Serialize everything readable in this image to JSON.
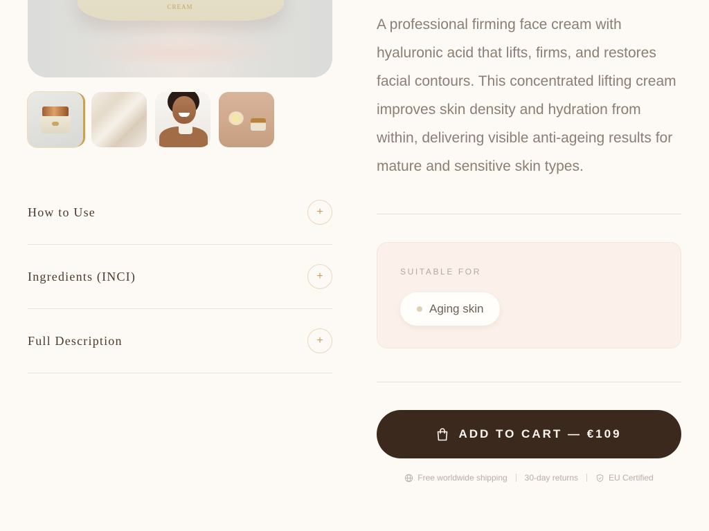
{
  "gallery": {
    "main_image_alt": "Firming face cream jar",
    "jar_label": "CREAM",
    "thumbnails": [
      {
        "name": "thumb-jar"
      },
      {
        "name": "thumb-cream-texture"
      },
      {
        "name": "thumb-model"
      },
      {
        "name": "thumb-flowers-jar"
      }
    ]
  },
  "accordion": [
    {
      "title": "How to Use",
      "icon": "plus-icon",
      "symbol": "+"
    },
    {
      "title": "Ingredients (INCI)",
      "icon": "plus-icon",
      "symbol": "+"
    },
    {
      "title": "Full Description",
      "icon": "plus-icon",
      "symbol": "+"
    }
  ],
  "description": "A professional firming face cream with hyaluronic acid that lifts, firms, and restores facial contours. This concentrated lifting cream improves skin density and hydration from within, delivering visible anti-ageing results for mature and sensitive skin types.",
  "suitable_for": {
    "label": "SUITABLE FOR",
    "chips": [
      "Aging skin"
    ]
  },
  "cart": {
    "label": "ADD TO CART — €109",
    "icon": "shopping-bag-icon"
  },
  "trust": [
    {
      "text": "Free worldwide shipping",
      "icon": "globe-icon"
    },
    {
      "text": "30-day returns",
      "icon": ""
    },
    {
      "text": "EU Certified",
      "icon": "shield-check-icon"
    }
  ],
  "colors": {
    "background": "#fdf9f4",
    "cart_button": "#3b291e",
    "accent_gold": "#c3a15c",
    "body_text": "#8b7e74"
  }
}
